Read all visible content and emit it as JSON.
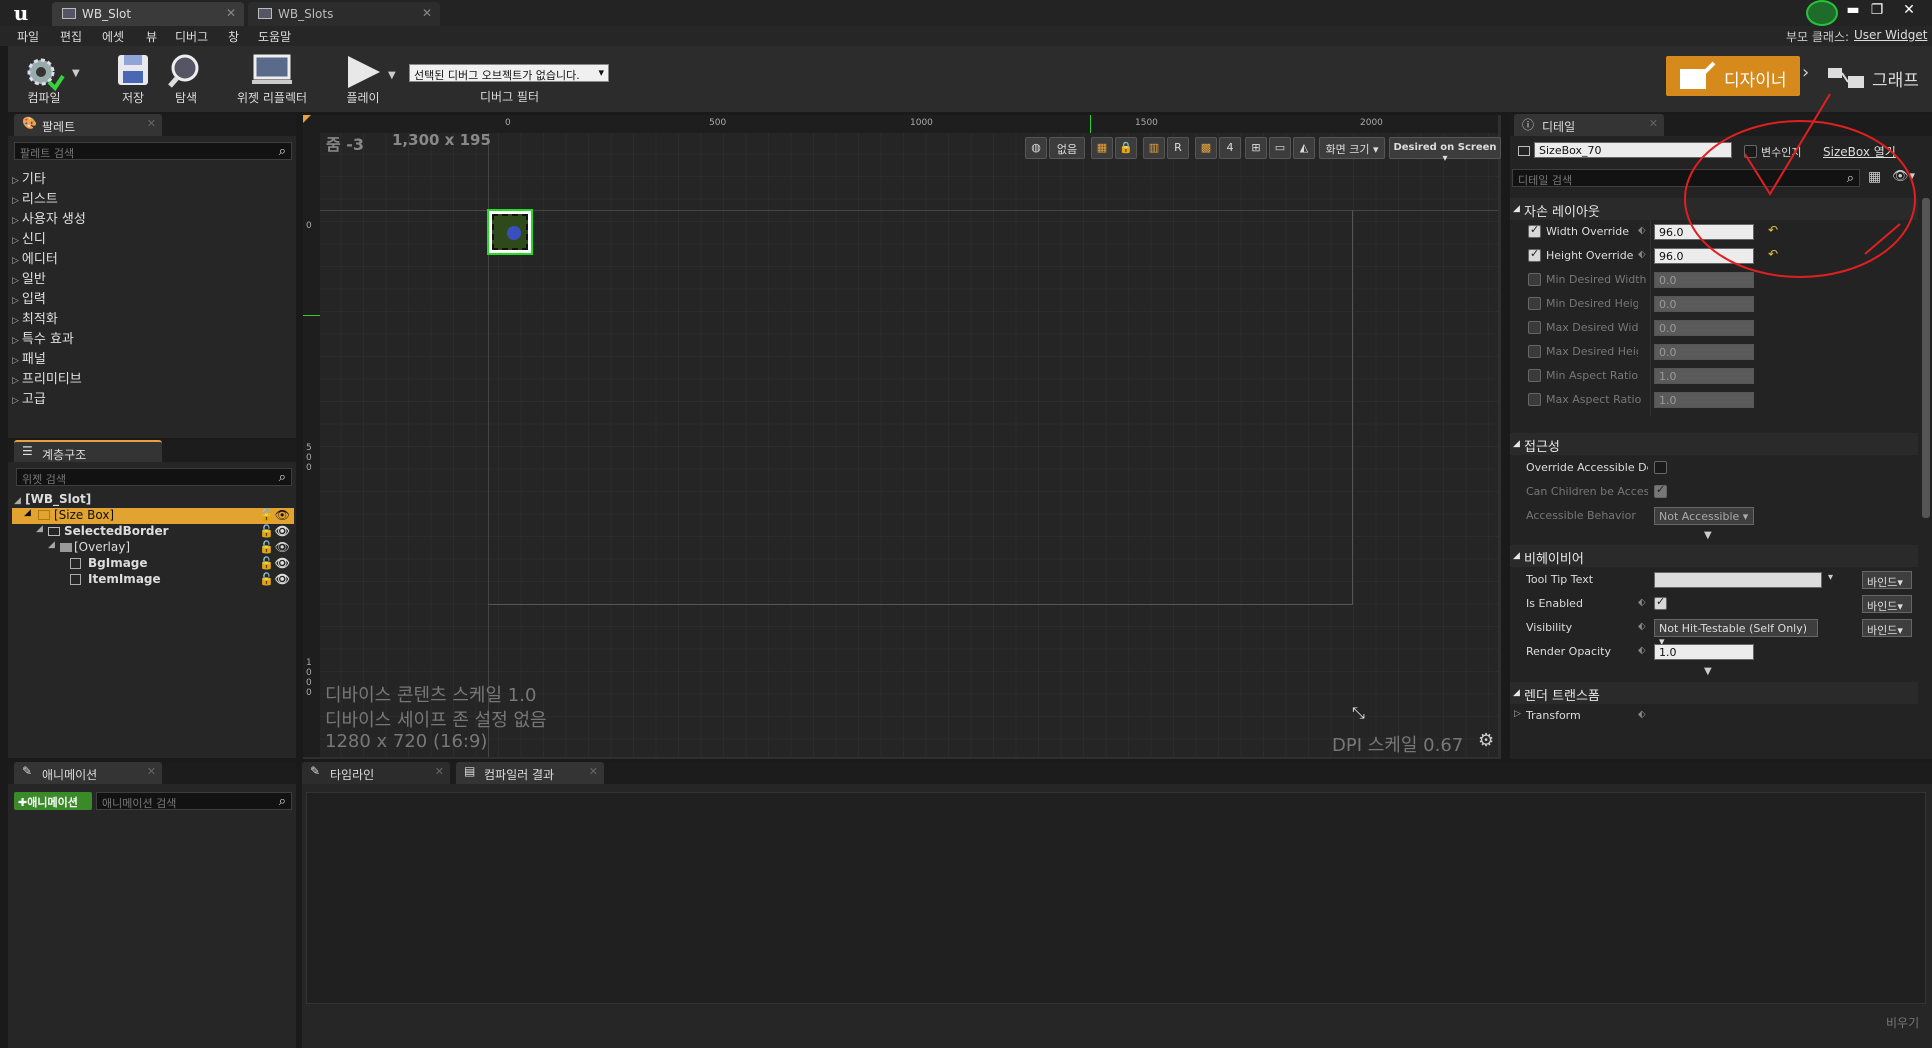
{
  "window": {
    "tabs": [
      {
        "label": "WB_Slot"
      },
      {
        "label": "WB_Slots"
      }
    ],
    "parent_class_label": "부모 클래스:",
    "parent_class_value": "User Widget",
    "win_buttons": [
      "▬",
      "❐",
      "✕"
    ]
  },
  "menu": [
    "파일",
    "편집",
    "에셋",
    "뷰",
    "디버그",
    "창",
    "도움말"
  ],
  "toolbar": {
    "compile": "컴파일",
    "save": "저장",
    "browse": "탐색",
    "reflector": "위젯 리플렉터",
    "play": "플레이",
    "debug_object": "선택된 디버그 오브젝트가 없습니다.",
    "debug_filter": "디버그 필터",
    "designer": "디자이너",
    "graph": "그래프"
  },
  "palette": {
    "tab": "팔레트",
    "search_placeholder": "팔레트 검색",
    "items": [
      "기타",
      "리스트",
      "사용자 생성",
      "신디",
      "에디터",
      "일반",
      "입력",
      "최적화",
      "특수 효과",
      "패널",
      "프리미티브",
      "고급"
    ]
  },
  "hierarchy": {
    "tab": "계층구조",
    "search_placeholder": "위젯 검색",
    "rows": [
      {
        "label": "[WB_Slot]",
        "depth": 0
      },
      {
        "label": "[Size Box]",
        "depth": 1
      },
      {
        "label": "SelectedBorder",
        "depth": 2
      },
      {
        "label": "[Overlay]",
        "depth": 3
      },
      {
        "label": "BgImage",
        "depth": 4
      },
      {
        "label": "ItemImage",
        "depth": 4
      }
    ]
  },
  "viewport": {
    "zoom": "줌 -3",
    "size": "1,300 x 195",
    "ruler_top": [
      "0",
      "500",
      "1000",
      "1500",
      "2000"
    ],
    "ruler_left": [
      "0",
      "500",
      "1000"
    ],
    "none_label": "없음",
    "r_label": "R",
    "grid_num": "4",
    "screen_size": "화면 크기",
    "desired": "Desired on Screen",
    "info1": "디바이스 콘텐츠 스케일 1.0",
    "info2": "디바이스 세이프 존 설정 없음",
    "info3": "1280 x 720 (16:9)",
    "dpi": "DPI 스케일 0.67"
  },
  "details": {
    "tab": "디테일",
    "name_value": "SizeBox_70",
    "is_variable": "변수인지",
    "open_link": "SizeBox 열기",
    "search_placeholder": "디테일 검색",
    "sections": {
      "child_layout": "자손 레이아웃",
      "accessibility": "접근성",
      "behavior": "비헤이비어",
      "render": "렌더 트랜스폼"
    },
    "layout_props": [
      {
        "label": "Width Override",
        "value": "96.0",
        "on": true
      },
      {
        "label": "Height Override",
        "value": "96.0",
        "on": true
      },
      {
        "label": "Min Desired Width",
        "value": "0.0",
        "on": false
      },
      {
        "label": "Min Desired Height",
        "value": "0.0",
        "on": false
      },
      {
        "label": "Max Desired Width",
        "value": "0.0",
        "on": false
      },
      {
        "label": "Max Desired Height",
        "value": "0.0",
        "on": false
      },
      {
        "label": "Min Aspect Ratio",
        "value": "1.0",
        "on": false
      },
      {
        "label": "Max Aspect Ratio",
        "value": "1.0",
        "on": false
      }
    ],
    "acc_props": [
      {
        "label": "Override Accessible Defaults"
      },
      {
        "label": "Can Children be Accessible"
      },
      {
        "label": "Accessible Behavior",
        "value": "Not Accessible"
      }
    ],
    "beh_props": {
      "tooltip": "Tool Tip Text",
      "enabled": "Is Enabled",
      "visibility": "Visibility",
      "visibility_value": "Not Hit-Testable (Self Only)",
      "opacity": "Render Opacity",
      "opacity_value": "1.0",
      "bind": "바인드"
    },
    "transform": "Transform"
  },
  "animations": {
    "tab": "애니메이션",
    "add_btn": "애니메이션",
    "search_placeholder": "애니메이션 검색"
  },
  "bottom": {
    "timeline": "타임라인",
    "compiler": "컴파일러 결과",
    "clear": "비우기"
  }
}
